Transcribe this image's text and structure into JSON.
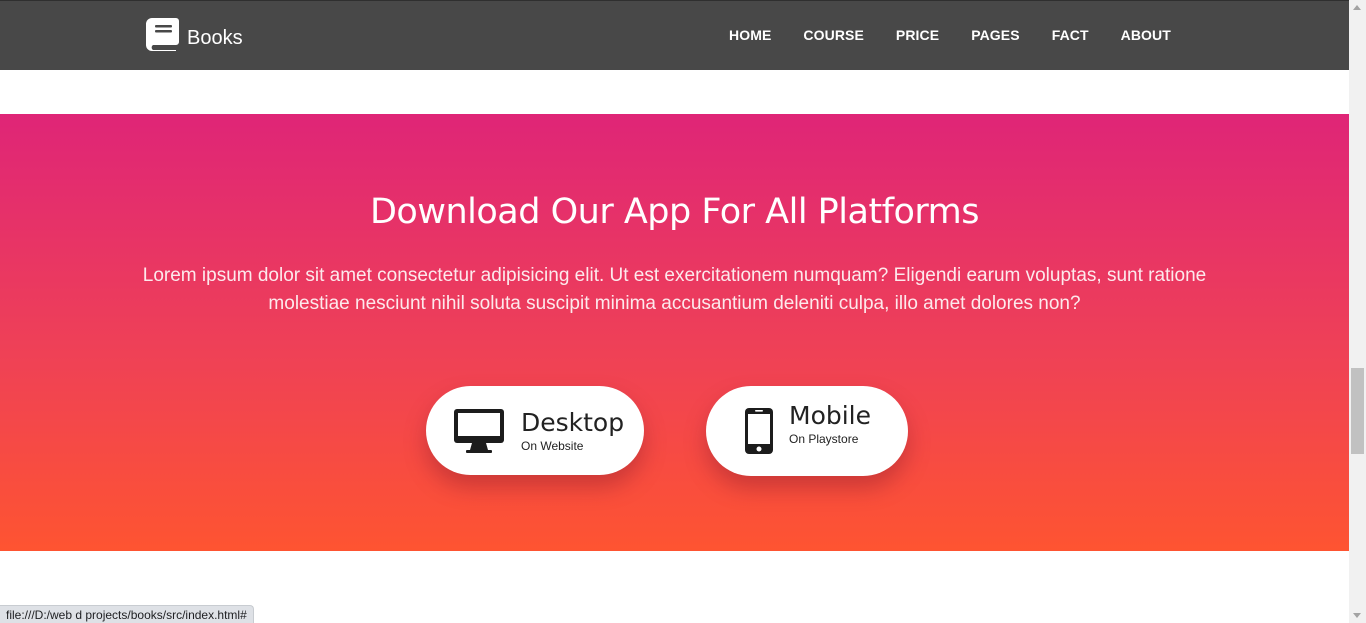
{
  "navbar": {
    "brand": {
      "label": "Books",
      "icon": "book-icon"
    },
    "links": [
      {
        "label": "HOME"
      },
      {
        "label": "COURSE"
      },
      {
        "label": "PRICE"
      },
      {
        "label": "PAGES"
      },
      {
        "label": "FACT"
      },
      {
        "label": "ABOUT"
      }
    ]
  },
  "download": {
    "title": "Download Our App For All Platforms",
    "description": "Lorem ipsum dolor sit amet consectetur adipisicing elit. Ut est exercitationem numquam? Eligendi earum voluptas, sunt ratione molestiae nesciunt nihil soluta suscipit minima accusantium deleniti culpa, illo amet dolores non?",
    "buttons": [
      {
        "title": "Desktop",
        "subtitle": "On Website",
        "icon": "desktop-icon"
      },
      {
        "title": "Mobile",
        "subtitle": "On Playstore",
        "icon": "mobile-phone-icon"
      }
    ],
    "gradient_colors": [
      "#df2577",
      "#fe5431"
    ]
  },
  "status_bar": {
    "url": "file:///D:/web d projects/books/src/index.html#"
  },
  "colors": {
    "navbar_bg": "#484848",
    "button_text": "#222222"
  }
}
